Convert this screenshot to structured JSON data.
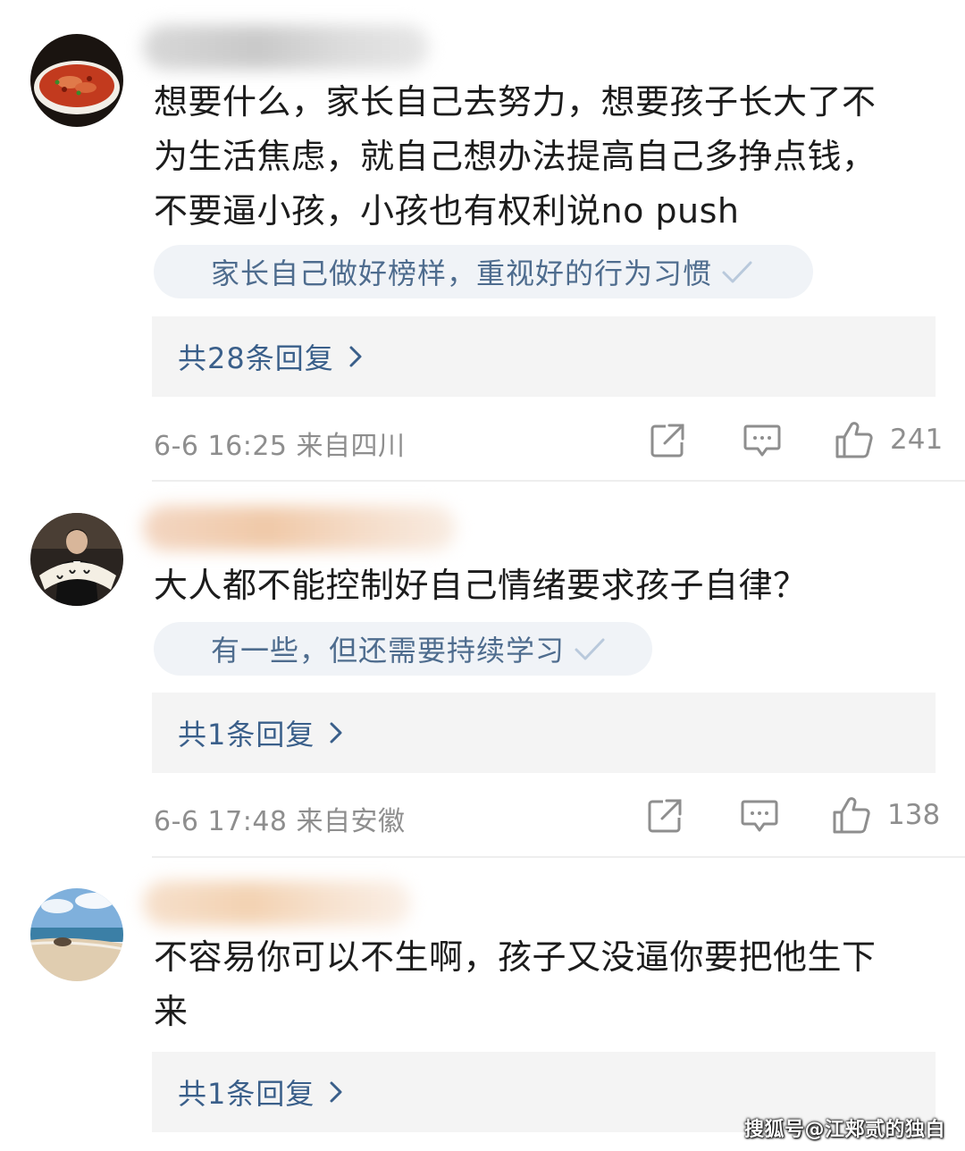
{
  "comments": [
    {
      "text_lines": [
        "想要什么，家长自己去努力，想要孩子长大了不",
        "为生活焦虑，就自己想办法提高自己多挣点钱，",
        "不要逼小孩，小孩也有权利说no push"
      ],
      "tag": "家长自己做好榜样，重视好的行为习惯",
      "replies": "共28条回复",
      "time_location": "6-6 16:25  来自四川",
      "likes": "241",
      "avatar_icon": "food-dish-avatar"
    },
    {
      "text_lines": [
        "大人都不能控制好自己情绪要求孩子自律？"
      ],
      "tag": "有一些，但还需要持续学习",
      "replies": "共1条回复",
      "time_location": "6-6 17:48  来自安徽",
      "likes": "138",
      "avatar_icon": "person-with-fan-avatar"
    },
    {
      "text_lines": [
        "不容易你可以不生啊，孩子又没逼你要把他生下",
        "来"
      ],
      "replies": "共1条回复",
      "avatar_icon": "beach-avatar"
    }
  ],
  "watermark": "搜狐号@江郏贰的独白",
  "colors": {
    "link_blue": "#3a5f8a",
    "tag_bg": "#f0f3f7",
    "reply_bg": "#f4f4f4",
    "meta_gray": "#8e8e8e"
  },
  "icons": [
    "share-icon",
    "comment-icon",
    "like-icon",
    "check-icon",
    "chevron-right-icon"
  ]
}
